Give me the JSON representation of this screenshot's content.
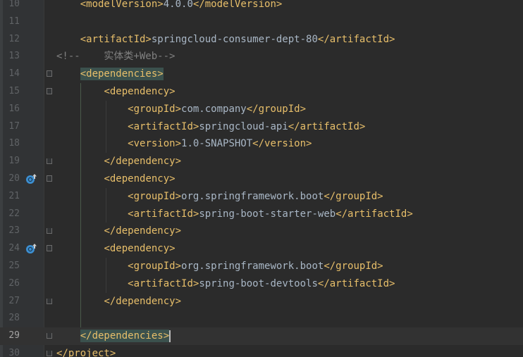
{
  "editor": {
    "lines": [
      {
        "num": "10",
        "indent": "    ",
        "segments": [
          {
            "t": "tag",
            "v": "<modelVersion>"
          },
          {
            "t": "txt",
            "v": "4.0.0"
          },
          {
            "t": "tag",
            "v": "</modelVersion>"
          }
        ]
      },
      {
        "num": "11",
        "indent": "",
        "segments": []
      },
      {
        "num": "12",
        "indent": "    ",
        "segments": [
          {
            "t": "tag",
            "v": "<artifactId>"
          },
          {
            "t": "txt",
            "v": "springcloud-consumer-dept-80"
          },
          {
            "t": "tag",
            "v": "</artifactId>"
          }
        ]
      },
      {
        "num": "13",
        "indent": "",
        "segments": [
          {
            "t": "cmt",
            "v": "<!--    实体类+Web-->"
          }
        ]
      },
      {
        "num": "14",
        "indent": "    ",
        "segments": [
          {
            "t": "hl",
            "v": "<dependencies>"
          }
        ],
        "fold": "start"
      },
      {
        "num": "15",
        "indent": "        ",
        "segments": [
          {
            "t": "tag",
            "v": "<dependency>"
          }
        ],
        "fold": "start"
      },
      {
        "num": "16",
        "indent": "            ",
        "segments": [
          {
            "t": "tag",
            "v": "<groupId>"
          },
          {
            "t": "txt",
            "v": "com.company"
          },
          {
            "t": "tag",
            "v": "</groupId>"
          }
        ]
      },
      {
        "num": "17",
        "indent": "            ",
        "segments": [
          {
            "t": "tag",
            "v": "<artifactId>"
          },
          {
            "t": "txt",
            "v": "springcloud-api"
          },
          {
            "t": "tag",
            "v": "</artifactId>"
          }
        ]
      },
      {
        "num": "18",
        "indent": "            ",
        "segments": [
          {
            "t": "tag",
            "v": "<version>"
          },
          {
            "t": "txt",
            "v": "1.0-SNAPSHOT"
          },
          {
            "t": "tag",
            "v": "</version>"
          }
        ]
      },
      {
        "num": "19",
        "indent": "        ",
        "segments": [
          {
            "t": "tag",
            "v": "</dependency>"
          }
        ],
        "fold": "end"
      },
      {
        "num": "20",
        "indent": "        ",
        "segments": [
          {
            "t": "tag",
            "v": "<dependency>"
          }
        ],
        "fold": "start",
        "gutter_icon": "override-up-arrow-icon"
      },
      {
        "num": "21",
        "indent": "            ",
        "segments": [
          {
            "t": "tag",
            "v": "<groupId>"
          },
          {
            "t": "txt",
            "v": "org.springframework.boot"
          },
          {
            "t": "tag",
            "v": "</groupId>"
          }
        ]
      },
      {
        "num": "22",
        "indent": "            ",
        "segments": [
          {
            "t": "tag",
            "v": "<artifactId>"
          },
          {
            "t": "txt",
            "v": "spring-boot-starter-web"
          },
          {
            "t": "tag",
            "v": "</artifactId>"
          }
        ]
      },
      {
        "num": "23",
        "indent": "        ",
        "segments": [
          {
            "t": "tag",
            "v": "</dependency>"
          }
        ],
        "fold": "end"
      },
      {
        "num": "24",
        "indent": "        ",
        "segments": [
          {
            "t": "tag",
            "v": "<dependency>"
          }
        ],
        "fold": "start",
        "gutter_icon": "override-up-arrow-icon"
      },
      {
        "num": "25",
        "indent": "            ",
        "segments": [
          {
            "t": "tag",
            "v": "<groupId>"
          },
          {
            "t": "txt",
            "v": "org.springframework.boot"
          },
          {
            "t": "tag",
            "v": "</groupId>"
          }
        ]
      },
      {
        "num": "26",
        "indent": "            ",
        "segments": [
          {
            "t": "tag",
            "v": "<artifactId>"
          },
          {
            "t": "txt",
            "v": "spring-boot-devtools"
          },
          {
            "t": "tag",
            "v": "</artifactId>"
          }
        ]
      },
      {
        "num": "27",
        "indent": "        ",
        "segments": [
          {
            "t": "tag",
            "v": "</dependency>"
          }
        ],
        "fold": "end"
      },
      {
        "num": "28",
        "indent": "",
        "segments": []
      },
      {
        "num": "29",
        "indent": "    ",
        "segments": [
          {
            "t": "hl",
            "v": "</dependencies>"
          }
        ],
        "fold": "end",
        "current": true,
        "caret": true
      },
      {
        "num": "30",
        "indent": "",
        "segments": [
          {
            "t": "tag",
            "v": "</project>"
          }
        ],
        "fold": "end"
      }
    ],
    "colors": {
      "background": "#2b2b2b",
      "gutter": "#313335",
      "tag": "#e8bf6a",
      "text": "#a9b7c6",
      "comment": "#808080",
      "tag_match_highlight": "#3b514d",
      "override_icon": "#3d8fd1"
    }
  }
}
